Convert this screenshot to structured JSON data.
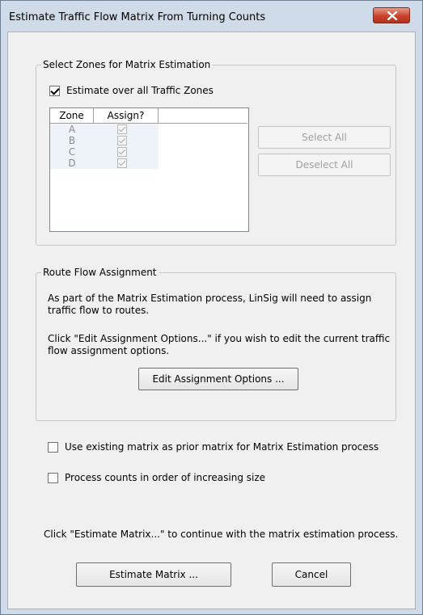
{
  "window": {
    "title": "Estimate Traffic Flow Matrix From Turning Counts",
    "close_icon": "close-icon"
  },
  "zones_group": {
    "label": "Select Zones for Matrix Estimation",
    "all_zones_checkbox": {
      "label": "Estimate over all Traffic Zones",
      "checked": true
    },
    "table": {
      "columns": [
        "Zone",
        "Assign?"
      ],
      "rows": [
        {
          "zone": "A",
          "assign": true
        },
        {
          "zone": "B",
          "assign": true
        },
        {
          "zone": "C",
          "assign": true
        },
        {
          "zone": "D",
          "assign": true
        }
      ]
    },
    "select_all_label": "Select All",
    "deselect_all_label": "Deselect All"
  },
  "route_group": {
    "label": "Route Flow Assignment",
    "text1": "As part of the Matrix Estimation process, LinSig will need to assign traffic flow to routes.",
    "text2": "Click \"Edit Assignment Options...\" if you wish to edit the current traffic flow assignment options.",
    "edit_button_label": "Edit Assignment Options ..."
  },
  "options": {
    "prior_matrix": {
      "label": "Use existing matrix as prior matrix for Matrix Estimation process",
      "checked": false
    },
    "increasing_size": {
      "label": "Process counts in order of increasing size",
      "checked": false
    }
  },
  "footer": {
    "text": "Click \"Estimate Matrix...\" to continue with the matrix estimation process.",
    "estimate_button_label": "Estimate Matrix ...",
    "cancel_button_label": "Cancel"
  }
}
